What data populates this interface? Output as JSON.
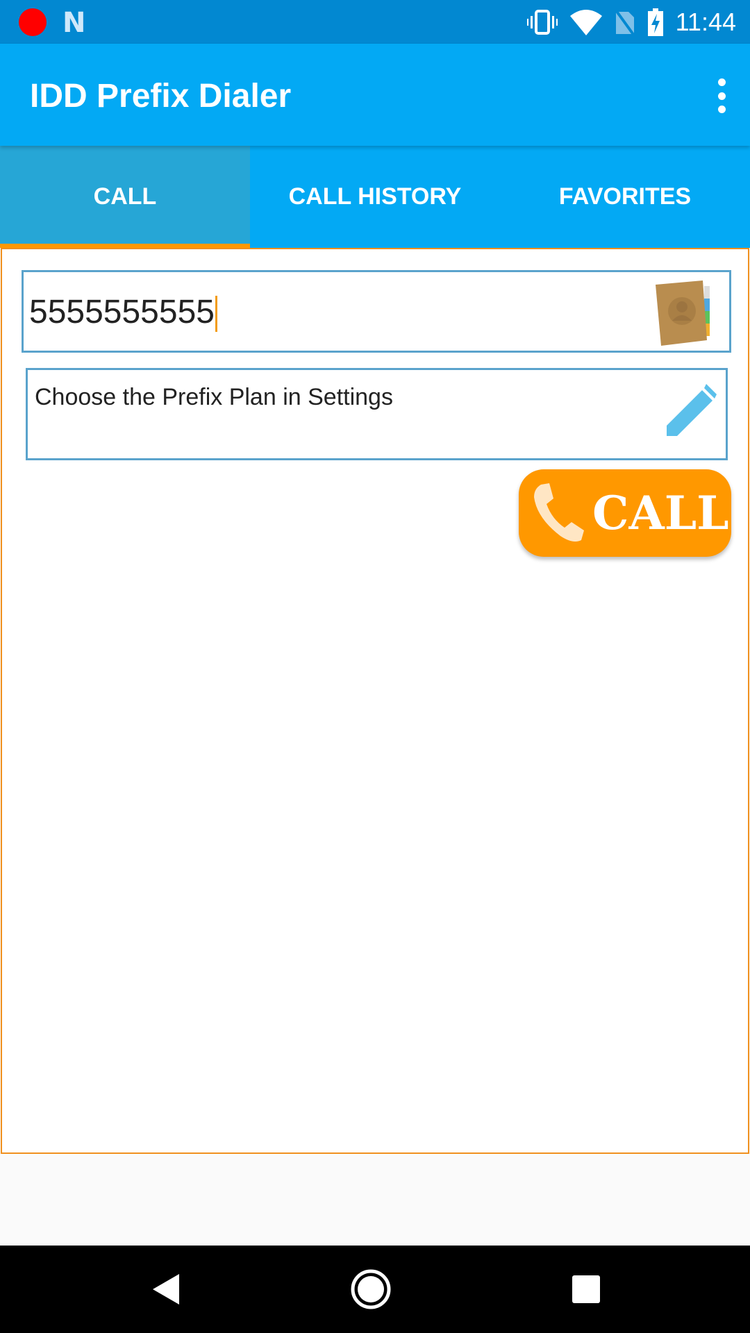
{
  "status_bar": {
    "time": "11:44",
    "icons": [
      "record-icon",
      "n-icon",
      "vibrate-icon",
      "wifi-icon",
      "no-sim-icon",
      "battery-charging-icon"
    ]
  },
  "app_bar": {
    "title": "IDD Prefix Dialer",
    "menu_icon": "more-vert-icon"
  },
  "tabs": [
    {
      "label": "CALL",
      "active": true
    },
    {
      "label": "CALL HISTORY",
      "active": false
    },
    {
      "label": "FAVORITES",
      "active": false
    }
  ],
  "call_form": {
    "phone_number": "5555555555",
    "prefix_plan_text": "Choose the Prefix Plan in Settings",
    "call_button_label": "CALL"
  },
  "nav_bar": {
    "icons": [
      "back-icon",
      "home-icon",
      "recents-icon"
    ]
  },
  "colors": {
    "primary": "#03a9f4",
    "primary_dark": "#0288d1",
    "accent": "#ff9800",
    "field_border": "#5aa3cc"
  }
}
